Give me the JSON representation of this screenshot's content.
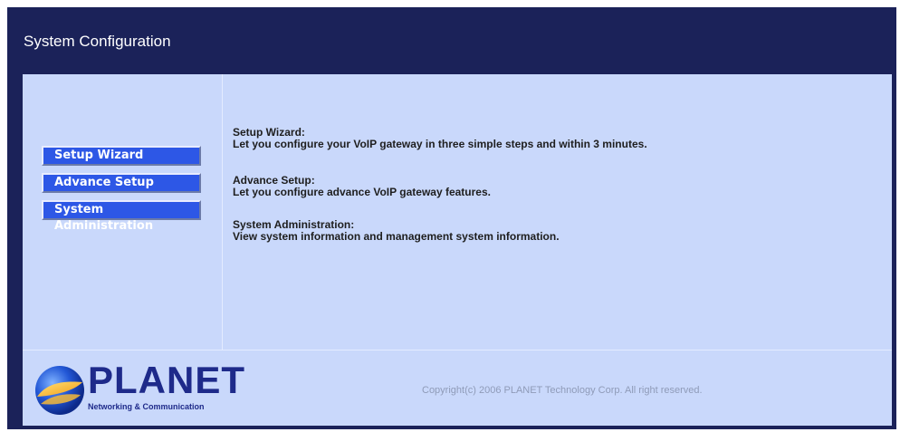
{
  "header": {
    "title": "System Configuration"
  },
  "nav": {
    "items": [
      {
        "label": "Setup Wizard"
      },
      {
        "label": "Advance Setup"
      },
      {
        "label": "System Administration"
      }
    ]
  },
  "descriptions": [
    {
      "heading": "Setup Wizard:",
      "text": "Let you configure your VoIP gateway in three simple steps and within 3 minutes."
    },
    {
      "heading": "Advance Setup:",
      "text": "Let you configure advance VoIP gateway features."
    },
    {
      "heading": "System Administration:",
      "text": "View system information and management system information."
    }
  ],
  "footer": {
    "logo_text": "PLANET",
    "logo_subtext": "Networking & Communication",
    "copyright": "Copyright(c) 2006 PLANET Technology Corp. All right reserved."
  },
  "colors": {
    "frame": "#1b2259",
    "panel": "#c9d8fb",
    "button": "#2d57e6"
  }
}
